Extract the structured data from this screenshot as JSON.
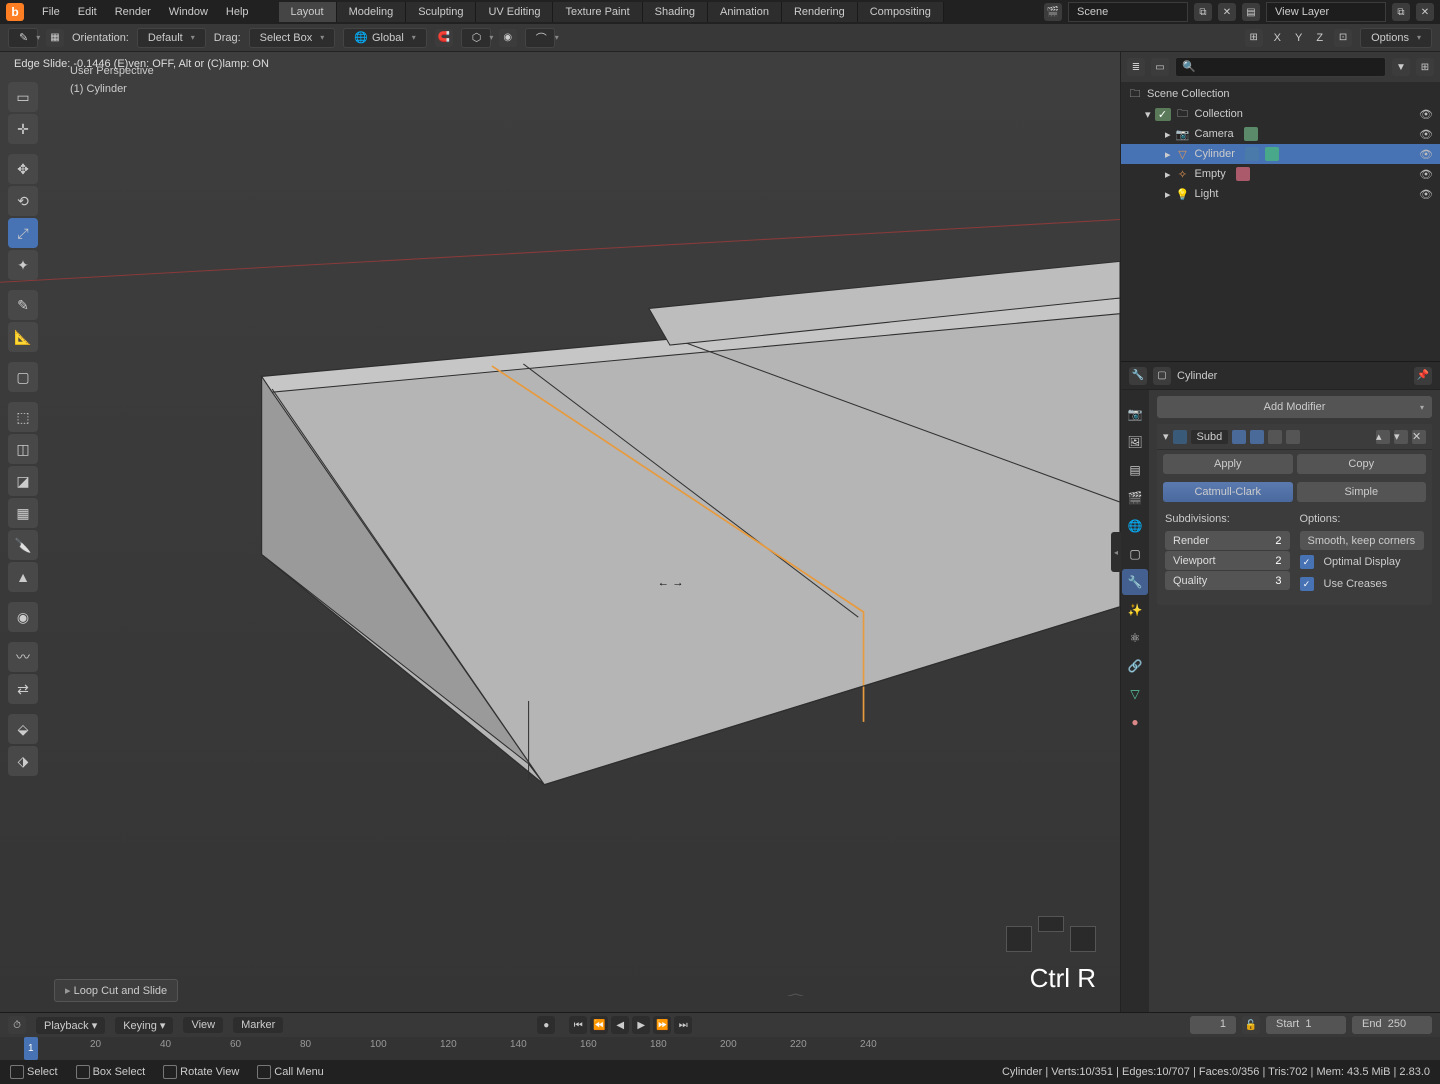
{
  "menubar": [
    "File",
    "Edit",
    "Render",
    "Window",
    "Help"
  ],
  "workspaces": [
    "Layout",
    "Modeling",
    "Sculpting",
    "UV Editing",
    "Texture Paint",
    "Shading",
    "Animation",
    "Rendering",
    "Compositing"
  ],
  "active_workspace": "Layout",
  "scene_label": "Scene",
  "viewlayer_label": "View Layer",
  "toolbar2": {
    "orientation_label": "Orientation:",
    "orientation_value": "Default",
    "drag_label": "Drag:",
    "drag_value": "Select Box",
    "transform_value": "Global",
    "options_label": "Options"
  },
  "viewport": {
    "status": "Edge Slide: -0.1446 (E)ven: OFF, Alt or (C)lamp: ON",
    "persp": "User Perspective",
    "obj": "(1) Cylinder",
    "last_op": "Loop Cut and Slide",
    "key_hint": "Ctrl R",
    "axes": [
      "X",
      "Y",
      "Z"
    ]
  },
  "outliner": {
    "root": "Scene Collection",
    "collection": "Collection",
    "items": [
      {
        "name": "Camera",
        "selected": false
      },
      {
        "name": "Cylinder",
        "selected": true
      },
      {
        "name": "Empty",
        "selected": false
      },
      {
        "name": "Light",
        "selected": false
      }
    ]
  },
  "props": {
    "context_name": "Cylinder",
    "add_modifier": "Add Modifier",
    "mod_name": "Subd",
    "apply": "Apply",
    "copy": "Copy",
    "seg_a": "Catmull-Clark",
    "seg_b": "Simple",
    "subdiv_label": "Subdivisions:",
    "options_label": "Options:",
    "render_label": "Render",
    "render_val": "2",
    "viewport_label": "Viewport",
    "viewport_val": "2",
    "quality_label": "Quality",
    "quality_val": "3",
    "uv_label": "Smooth, keep corners",
    "opt1": "Optimal Display",
    "opt2": "Use Creases"
  },
  "timeline": {
    "menus": [
      "Playback",
      "Keying",
      "View",
      "Marker"
    ],
    "current": "1",
    "start_label": "Start",
    "start": "1",
    "end_label": "End",
    "end": "250",
    "ticks": [
      "20",
      "40",
      "60",
      "80",
      "100",
      "120",
      "140",
      "160",
      "180",
      "200",
      "220",
      "240"
    ],
    "frame": "1"
  },
  "statusbar": {
    "items": [
      "Select",
      "Box Select",
      "Rotate View",
      "Call Menu"
    ],
    "right": "Cylinder | Verts:10/351 | Edges:10/707 | Faces:0/356 | Tris:702 | Mem: 43.5 MiB | 2.83.0"
  }
}
